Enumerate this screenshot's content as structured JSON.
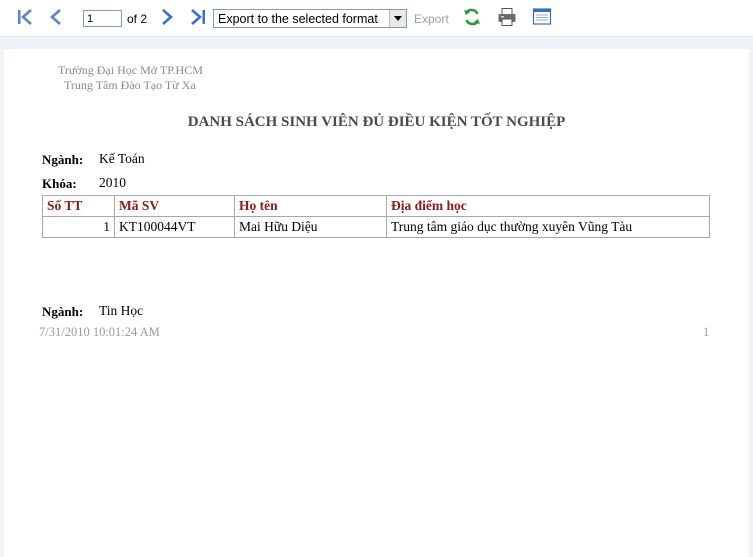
{
  "toolbar": {
    "first_page_icon": "first-page-icon",
    "prev_page_icon": "previous-page-icon",
    "current_page": "1",
    "page_count_text": "of 2",
    "next_page_icon": "next-page-icon",
    "last_page_icon": "last-page-icon",
    "export_format": "Export to the selected format",
    "export_label": "Export",
    "refresh_icon": "refresh-icon",
    "print_icon": "print-icon",
    "layout_icon": "print-layout-icon"
  },
  "report": {
    "school_line1": "Trường Đại Học Mở TP.HCM",
    "school_line2": "Trung Tâm Đào Tạo Từ Xa",
    "title": "DANH SÁCH SINH VIÊN ĐỦ ĐIỀU KIỆN TỐT NGHIỆP",
    "groups": [
      {
        "major_label": "Ngành:",
        "major": "Kế Toán",
        "year_label": "Khóa:",
        "year": "2010"
      },
      {
        "major_label": "Ngành:",
        "major": "Tin Học"
      }
    ],
    "table": {
      "headers": [
        "Số TT",
        "Mã SV",
        "Họ tên",
        "Địa điểm học"
      ],
      "rows": [
        [
          "1",
          "KT100044VT",
          "Mai Hữu Diệu",
          "Trung tâm giáo dục thường xuyên Vũng Tàu"
        ]
      ]
    },
    "footer_timestamp": "7/31/2010 10:01:24 AM",
    "footer_page_number": "1"
  },
  "colors": {
    "header_text": "#8b1a1a",
    "viewer_background": "#eef3fa",
    "nav_icon": "#5a86c4"
  }
}
